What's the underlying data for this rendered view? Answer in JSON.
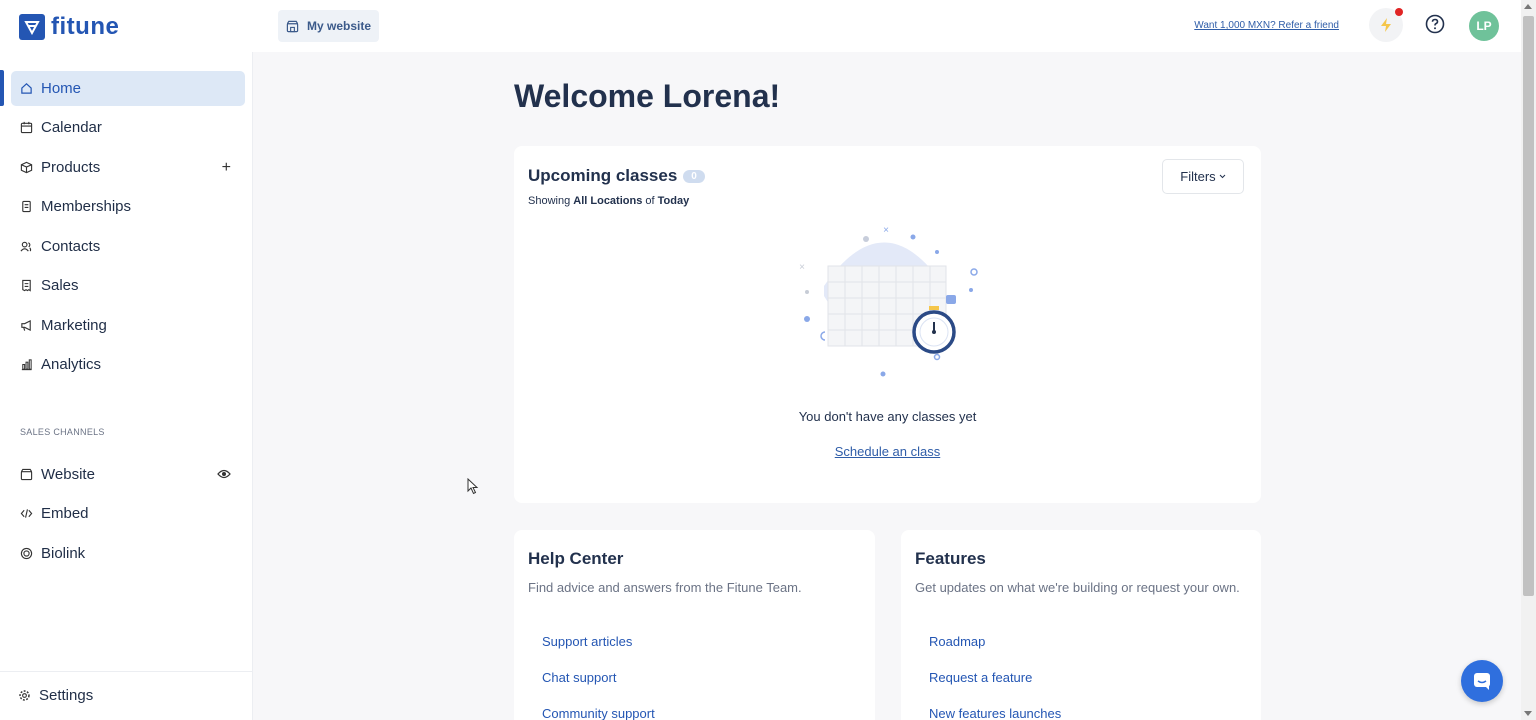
{
  "brand": {
    "name": "fitune",
    "color": "#2456b3"
  },
  "header": {
    "my_website_label": "My website",
    "refer_link": "Want 1,000 MXN? Refer a friend",
    "avatar_initials": "LP"
  },
  "sidebar": {
    "items": [
      {
        "label": "Home",
        "icon": "home-icon",
        "active": true
      },
      {
        "label": "Calendar",
        "icon": "calendar-icon"
      },
      {
        "label": "Products",
        "icon": "box-icon",
        "extra": "+"
      },
      {
        "label": "Memberships",
        "icon": "membership-icon"
      },
      {
        "label": "Contacts",
        "icon": "contacts-icon"
      },
      {
        "label": "Sales",
        "icon": "receipt-icon"
      },
      {
        "label": "Marketing",
        "icon": "megaphone-icon"
      },
      {
        "label": "Analytics",
        "icon": "bar-chart-icon"
      }
    ],
    "section_label": "SALES CHANNELS",
    "channels": [
      {
        "label": "Website",
        "icon": "website-icon",
        "extra_icon": "eye-icon"
      },
      {
        "label": "Embed",
        "icon": "code-icon"
      },
      {
        "label": "Biolink",
        "icon": "biolink-icon"
      }
    ],
    "settings_label": "Settings"
  },
  "main": {
    "welcome": "Welcome Lorena!",
    "classes": {
      "title": "Upcoming classes",
      "count": "0",
      "showing_prefix": "Showing",
      "showing_location": "All Locations",
      "showing_of": "of",
      "showing_period": "Today",
      "filters_label": "Filters",
      "empty_text": "You don't have any classes yet",
      "schedule_link": "Schedule an class"
    },
    "help_center": {
      "title": "Help Center",
      "description": "Find advice and answers from the Fitune Team.",
      "links": [
        "Support articles",
        "Chat support",
        "Community support"
      ]
    },
    "features": {
      "title": "Features",
      "description": "Get updates on what we're building or request your own.",
      "links": [
        "Roadmap",
        "Request a feature",
        "New features launches"
      ]
    }
  }
}
